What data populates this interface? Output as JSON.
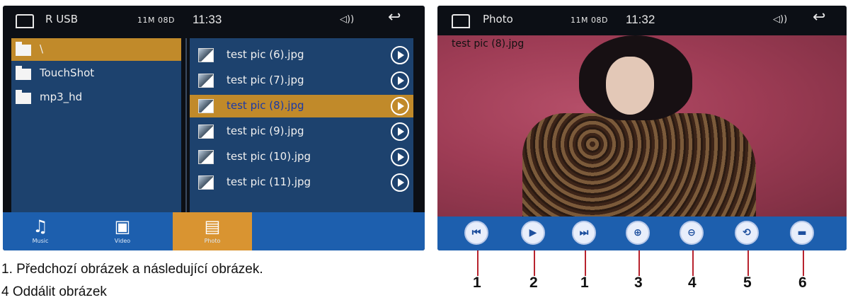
{
  "left_screen": {
    "status": {
      "title": "R USB",
      "info": "11M 08D",
      "time": "11:33",
      "volume_icon": "speaker-icon",
      "back_icon": "back-arrow-icon"
    },
    "folders": [
      {
        "label": "\\",
        "selected": true
      },
      {
        "label": "TouchShot",
        "selected": false
      },
      {
        "label": "mp3_hd",
        "selected": false
      }
    ],
    "files": [
      {
        "label": "test pic (6).jpg",
        "selected": false
      },
      {
        "label": "test pic (7).jpg",
        "selected": false
      },
      {
        "label": "test pic (8).jpg",
        "selected": true
      },
      {
        "label": "test pic (9).jpg",
        "selected": false
      },
      {
        "label": "test pic (10).jpg",
        "selected": false
      },
      {
        "label": "test pic (11).jpg",
        "selected": false
      }
    ],
    "tabs": [
      {
        "label": "Music",
        "glyph": "♫"
      },
      {
        "label": "Video",
        "glyph": "▣"
      },
      {
        "label": "Photo",
        "glyph": "▤",
        "active": true
      }
    ]
  },
  "right_screen": {
    "status": {
      "title": "Photo",
      "info": "11M 08D",
      "time": "11:32"
    },
    "caption": "test pic (8).jpg",
    "controls": [
      {
        "name": "previous-button",
        "glyph": "⏮",
        "number": "1"
      },
      {
        "name": "play-button",
        "glyph": "▶",
        "number": "2"
      },
      {
        "name": "next-button",
        "glyph": "⏭",
        "number": "1"
      },
      {
        "name": "zoom-in-button",
        "glyph": "⊕",
        "number": "3"
      },
      {
        "name": "zoom-out-button",
        "glyph": "⊖",
        "number": "4"
      },
      {
        "name": "rotate-button",
        "glyph": "⟲",
        "number": "5"
      },
      {
        "name": "folder-button",
        "glyph": "▬",
        "number": "6"
      }
    ]
  },
  "captions": {
    "line1": "1. Předchozí obrázek a následující obrázek.",
    "line2": "4 Oddálit obrázek"
  },
  "colors": {
    "panel": "#1d426e",
    "highlight": "#c18a2a",
    "tabbar": "#1d5fae"
  }
}
